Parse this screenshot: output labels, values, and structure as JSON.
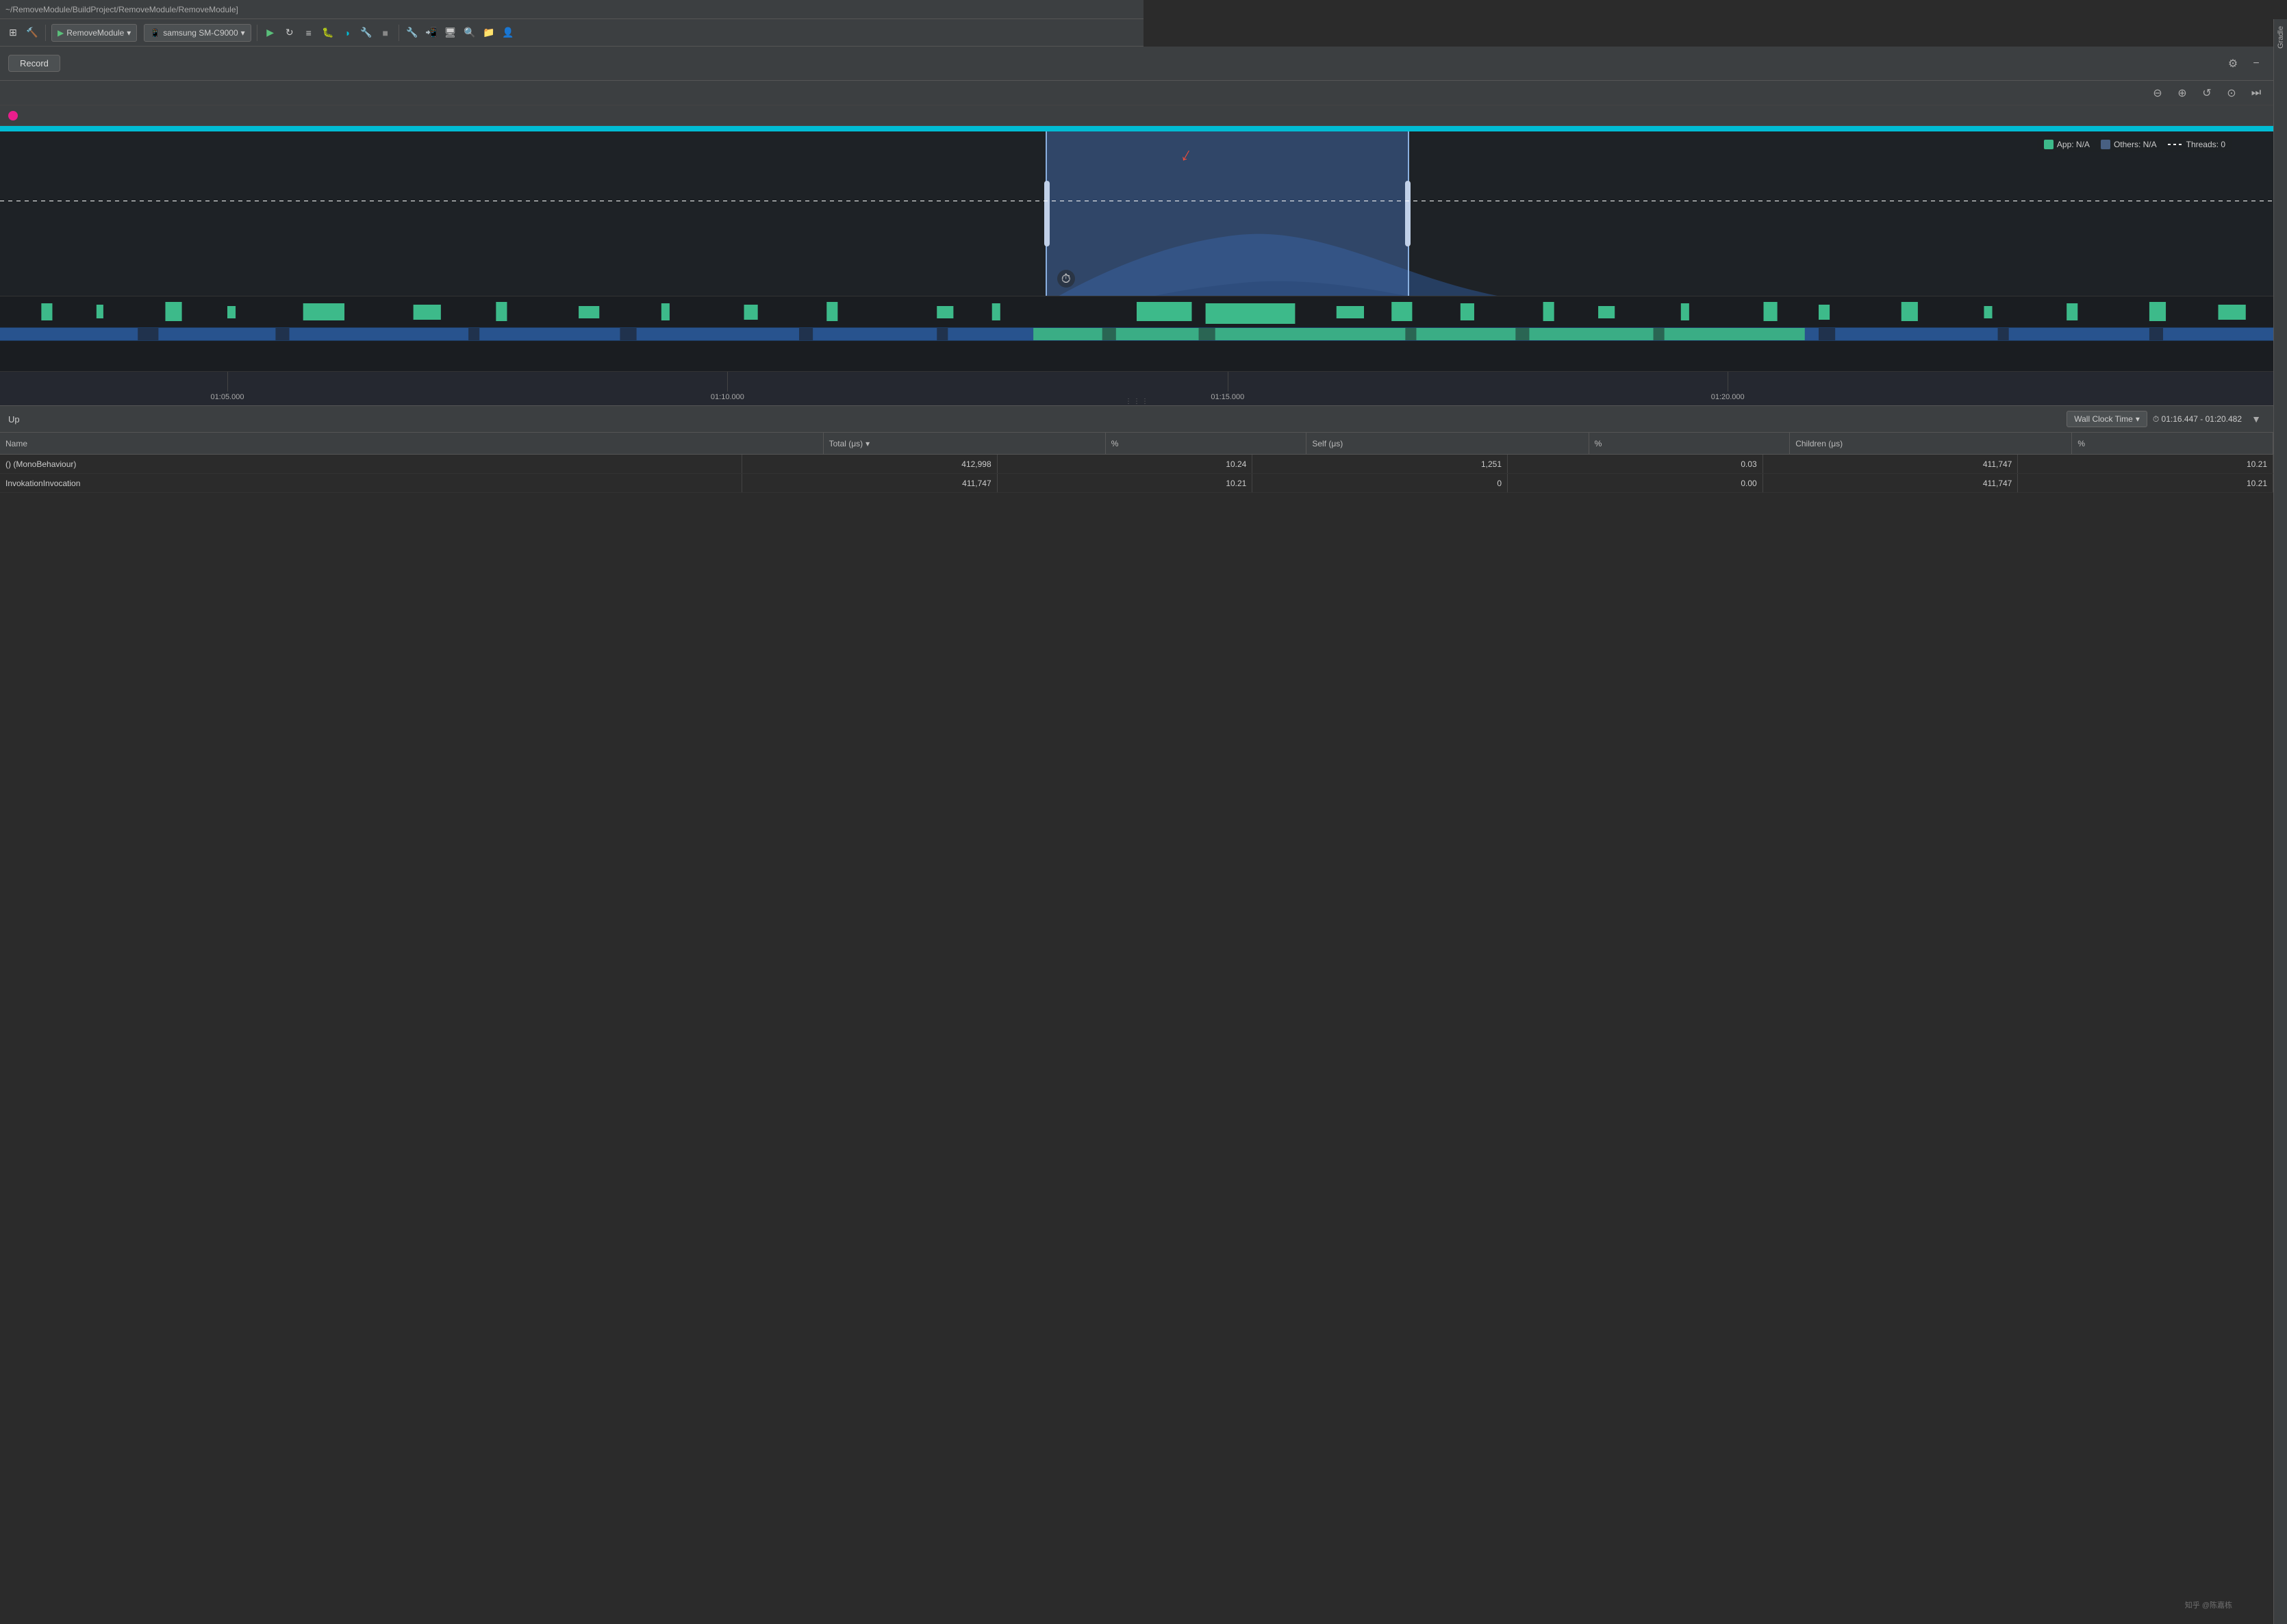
{
  "titlebar": {
    "path": "~/RemoveModule/BuildProject/RemoveModule/RemoveModule]"
  },
  "toolbar": {
    "module_label": "RemoveModule",
    "device_label": "samsung SM-C9000",
    "module_dropdown": "▾",
    "device_dropdown": "▾"
  },
  "profiler": {
    "record_button": "Record",
    "controls": [
      "−",
      "+",
      "↺",
      "⊙"
    ],
    "header_settings": "⚙",
    "header_minimize": "−"
  },
  "legend": {
    "app_label": "App: N/A",
    "others_label": "Others: N/A",
    "threads_label": "Threads: 0",
    "app_color": "#3dba8a",
    "others_color": "#5a7aaa"
  },
  "y_axis": {
    "max": "100",
    "mid": "50"
  },
  "timeline": {
    "ticks": [
      {
        "label": "01:05.000",
        "pct": "10"
      },
      {
        "label": "01:10.000",
        "pct": "32"
      },
      {
        "label": "01:15.000",
        "pct": "54"
      },
      {
        "label": "01:20.000",
        "pct": "76"
      }
    ]
  },
  "bottom_bar": {
    "up_label": "Up",
    "wall_clock_label": "Wall Clock Time",
    "time_range": "⏱ 01:16.447 - 01:20.482",
    "filter_icon": "▼"
  },
  "table": {
    "columns": [
      {
        "label": "Name",
        "width": "3"
      },
      {
        "label": "Total (μs)",
        "width": "1"
      },
      {
        "label": "%",
        "width": "0.7"
      },
      {
        "label": "Self (μs)",
        "width": "1"
      },
      {
        "label": "%",
        "width": "0.7"
      },
      {
        "label": "Children (μs)",
        "width": "1"
      },
      {
        "label": "%",
        "width": "0.7"
      }
    ],
    "rows": [
      {
        "name": "() (MonoBehaviour)",
        "total": "412,998",
        "total_pct": "10.24",
        "self": "1,251",
        "self_pct": "0.03",
        "children": "411,747",
        "children_pct": "10.21"
      },
      {
        "name": "InvokationInvocation",
        "total": "411,747",
        "total_pct": "10.21",
        "self": "0",
        "self_pct": "0.00",
        "children": "411,747",
        "children_pct": "10.21"
      }
    ]
  },
  "watermark": {
    "text": "知乎 @陈嘉栋"
  },
  "gradle": {
    "label": "Gradle"
  }
}
